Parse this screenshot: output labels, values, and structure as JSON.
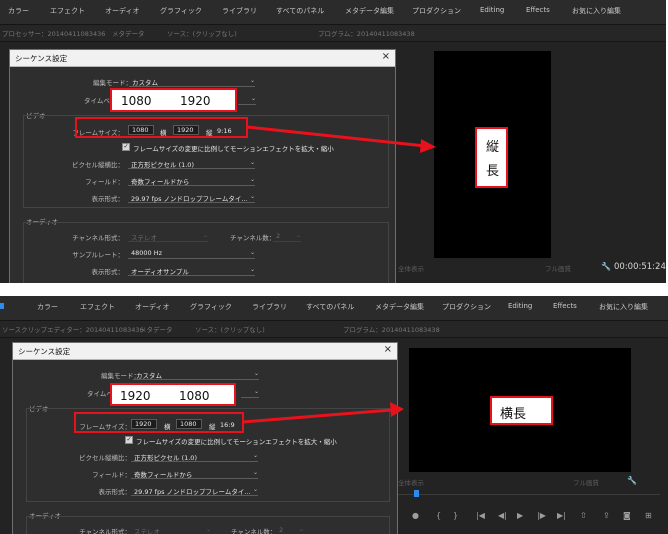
{
  "menu": {
    "items": [
      "カラー",
      "エフェクト",
      "オーディオ",
      "グラフィック",
      "ライブラリ",
      "すべてのパネル",
      "メタデータ編集",
      "プロダクション",
      "Editing",
      "Effects",
      "お気に入り編集"
    ]
  },
  "top": {
    "tabs": [
      "プロセッサー：20140411083436",
      "メタデータ",
      "ソース：(クリップなし)",
      "プログラム：20140411083438"
    ],
    "dialog": {
      "title": "シーケンス設定",
      "close": "×",
      "edit_mode_label": "編集モード：",
      "edit_mode_value": "カスタム",
      "timebase_label": "タイムベ",
      "video_section": "ビデオ",
      "frame_size_label": "フレームサイズ：",
      "width_value": "1080",
      "width_unit": "横",
      "height_value": "1920",
      "height_unit": "縦",
      "aspect": "9:16",
      "scale_checkbox": "フレームサイズの変更に比例してモーションエフェクトを拡大・縮小",
      "pixel_aspect_label": "ピクセル縦横比：",
      "pixel_aspect_value": "正方形ピクセル (1.0)",
      "field_label": "フィールド：",
      "field_value": "奇数フィールドから",
      "display_format_label": "表示形式：",
      "display_format_value": "29.97 fps ノンドロップフレームタイ...",
      "audio_section": "オーディオ",
      "channel_format_label": "チャンネル形式：",
      "channel_format_value": "ステレオ",
      "channel_count_label": "チャンネル数：",
      "channel_count_value": "2",
      "sample_rate_label": "サンプルレート：",
      "sample_rate_value": "48000 Hz",
      "audio_display_label": "表示形式：",
      "audio_display_value": "オーディオサンプル"
    },
    "callout_w": "1080",
    "callout_h": "1920",
    "caption_line1": "縦",
    "caption_line2": "長",
    "left_dim": "全体表示",
    "right_dim": "フル画質",
    "timecode": "00:00:51:24"
  },
  "bottom": {
    "tabs": [
      "ソースクリップエディター：20140411083436",
      "メタデータ",
      "ソース：(クリップなし)",
      "プログラム：20140411083438"
    ],
    "dialog": {
      "title": "シーケンス設定",
      "close": "×",
      "edit_mode_label": "編集モード：",
      "edit_mode_value": "カスタム",
      "timebase_label": "タイムベ",
      "video_section": "ビデオ",
      "frame_size_label": "フレームサイズ：",
      "width_value": "1920",
      "width_unit": "横",
      "height_value": "1080",
      "height_unit": "縦",
      "aspect": "16:9",
      "scale_checkbox": "フレームサイズの変更に比例してモーションエフェクトを拡大・縮小",
      "pixel_aspect_label": "ピクセル縦横比：",
      "pixel_aspect_value": "正方形ピクセル (1.0)",
      "field_label": "フィールド：",
      "field_value": "奇数フィールドから",
      "display_format_label": "表示形式：",
      "display_format_value": "29.97 fps ノンドロップフレームタイ...",
      "audio_section": "オーディオ",
      "channel_format_label": "チャンネル形式：",
      "channel_format_value": "ステレオ",
      "channel_count_label": "チャンネル数：",
      "channel_count_value": "2"
    },
    "callout_w": "1920",
    "callout_h": "1080",
    "caption": "横長",
    "left_dim": "全体表示",
    "right_dim": "フル画質"
  }
}
